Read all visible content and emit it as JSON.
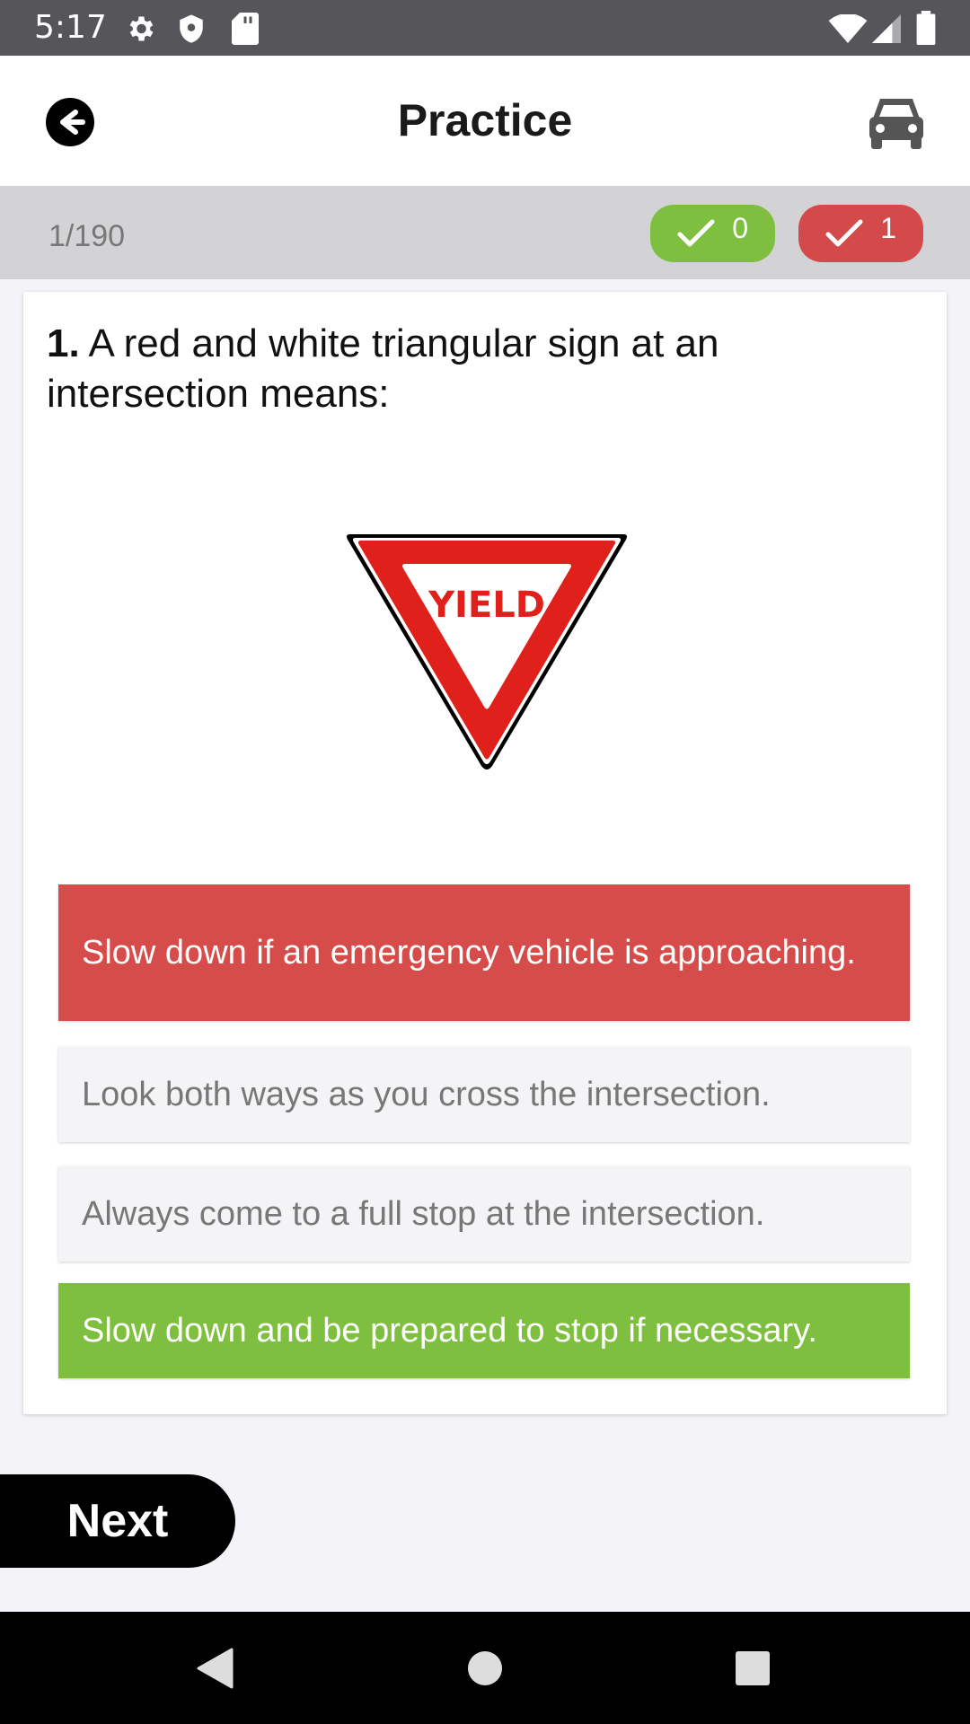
{
  "status_bar": {
    "time": "5:17",
    "icons": [
      "settings-icon",
      "shield-icon",
      "sd-card-icon",
      "wifi-icon",
      "signal-icon",
      "battery-icon"
    ]
  },
  "app_bar": {
    "title": "Practice",
    "back_icon": "arrow-left-circle-icon",
    "right_icon": "car-icon"
  },
  "progress": {
    "position": "1/190",
    "correct_count": "0",
    "wrong_count": "1"
  },
  "question": {
    "number": "1.",
    "text": " A red and white triangular sign at an intersection means:",
    "image": {
      "type": "yield-sign",
      "label": "YIELD"
    }
  },
  "options": [
    {
      "text": "Slow down if an emergency vehicle is approaching.",
      "state": "wrong"
    },
    {
      "text": "Look both ways as you cross the intersection.",
      "state": "neutral"
    },
    {
      "text": "Always come to a full stop at the intersection.",
      "state": "neutral"
    },
    {
      "text": "Slow down and be prepared to stop if necessary.",
      "state": "correct"
    }
  ],
  "next_label": "Next",
  "colors": {
    "correct": "#7fbf3f",
    "wrong": "#d44a4a",
    "status_bar": "#565559",
    "sign_red": "#e0201b"
  }
}
